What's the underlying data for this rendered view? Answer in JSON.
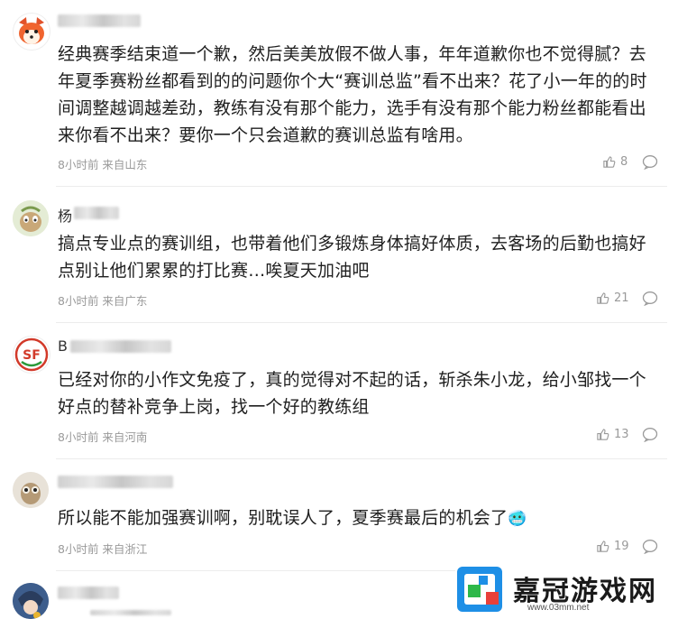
{
  "comments": [
    {
      "text": "经典赛季结束道一个歉，然后美美放假不做人事，年年道歉你也不觉得腻？去年夏季赛粉丝都看到的的问题你个大“赛训总监”看不出来？花了小一年的的时间调整越调越差劲，教练有没有那个能力，选手有没有那个能力粉丝都能看出来你看不出来？要你一个只会道歉的赛训总监有啥用。",
      "time_location": "8小时前 来自山东",
      "likes": "8"
    },
    {
      "name_partial": "杨",
      "text": "搞点专业点的赛训组，也带着他们多锻炼身体搞好体质，去客场的后勤也搞好点别让他们累累的打比赛…唉夏天加油吧",
      "time_location": "8小时前 来自广东",
      "likes": "21"
    },
    {
      "name_partial": "B",
      "text": "已经对你的小作文免疫了，真的觉得对不起的话，斩杀朱小龙，给小邹找一个好点的替补竞争上岗，找一个好的教练组",
      "time_location": "8小时前 来自河南",
      "likes": "13"
    },
    {
      "text": "所以能不能加强赛训啊，别耽误人了，夏季赛最后的机会了",
      "emoji": "🥶",
      "time_location": "8小时前 来自浙江",
      "likes": "19"
    }
  ],
  "watermark": {
    "title": "嘉冠游戏网",
    "url": "www.03mm.net"
  }
}
